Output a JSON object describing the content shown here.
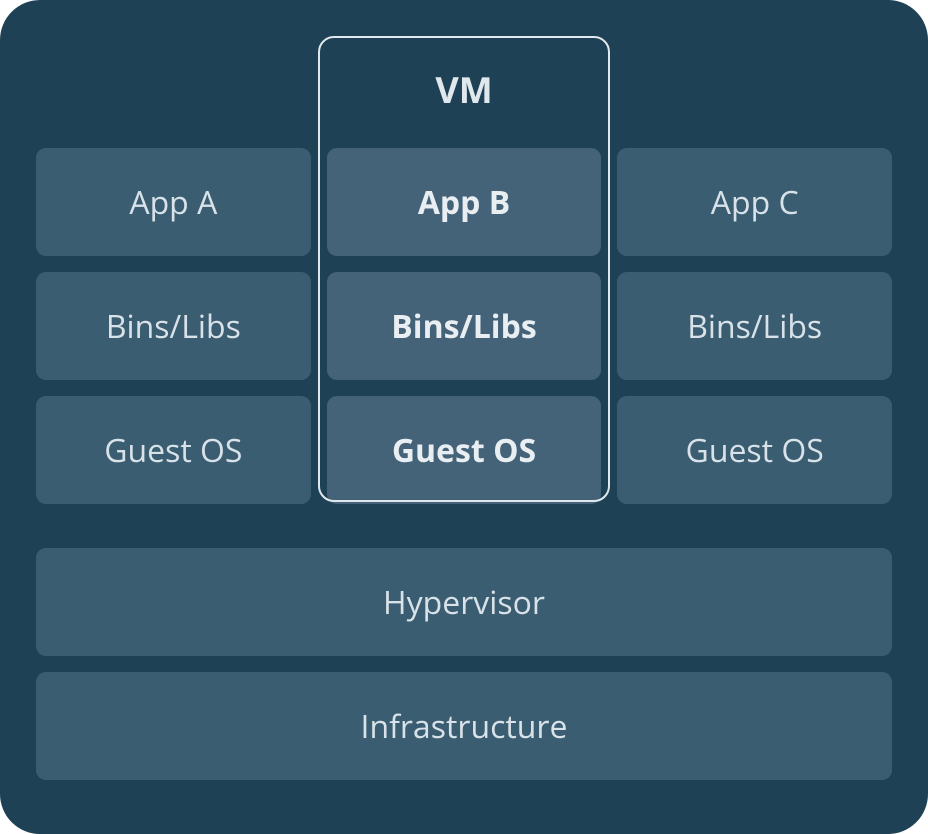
{
  "diagram": {
    "vm_label": "VM",
    "columns": [
      {
        "app": "App A",
        "bins": "Bins/Libs",
        "os": "Guest OS",
        "highlighted": false
      },
      {
        "app": "App B",
        "bins": "Bins/Libs",
        "os": "Guest OS",
        "highlighted": true
      },
      {
        "app": "App C",
        "bins": "Bins/Libs",
        "os": "Guest OS",
        "highlighted": false
      }
    ],
    "layers": {
      "hypervisor": "Hypervisor",
      "infrastructure": "Infrastructure"
    }
  }
}
